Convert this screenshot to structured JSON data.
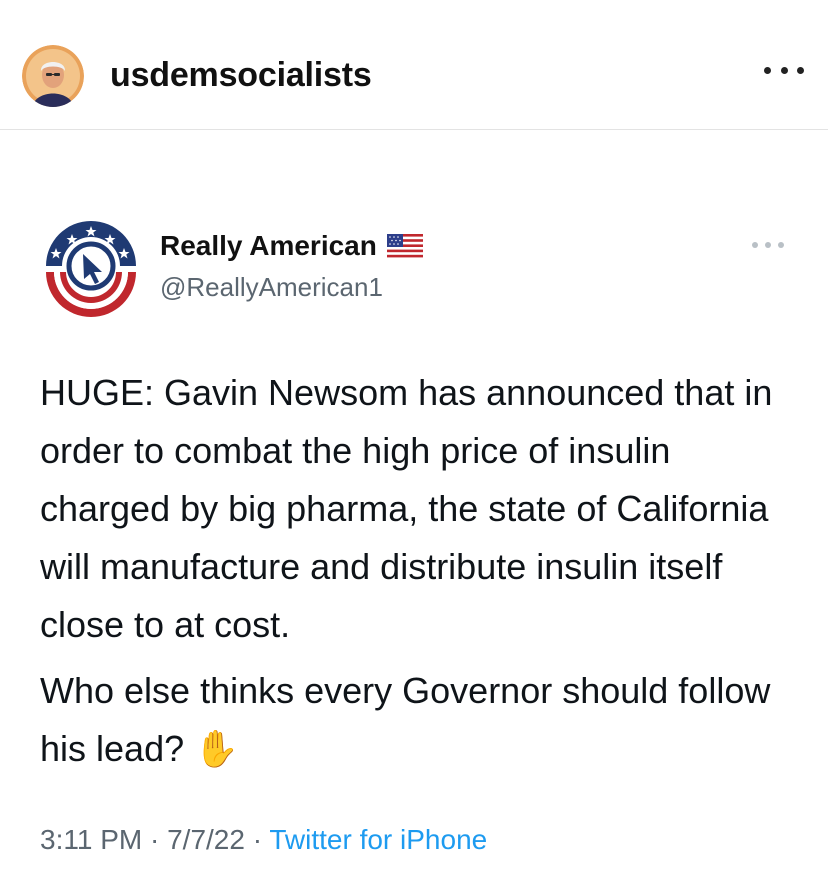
{
  "instagram_post": {
    "username": "usdemsocialists"
  },
  "tweet": {
    "display_name": "Really American",
    "flag_emoji": "🇺🇸",
    "handle": "@ReallyAmerican1",
    "paragraphs": [
      "HUGE: Gavin Newsom has announced that in order to combat the high price of insulin charged by big pharma, the state of California will manufacture and distribute insulin itself close to at cost.",
      "Who else thinks every Governor should follow his lead? ✋"
    ],
    "time": "3:11 PM",
    "date": "7/7/22",
    "separator": "·",
    "source": "Twitter for iPhone"
  },
  "colors": {
    "handle_gray": "#5b6670",
    "link_blue": "#1d9bf0",
    "logo_navy": "#1f3a73",
    "logo_red": "#c0272d"
  },
  "icons": {
    "ig_avatar": "avatar-portrait",
    "ig_more": "more-horizontal-icon",
    "tweet_more": "more-horizontal-icon",
    "tweet_logo": "really-american-logo",
    "flag": "us-flag-icon"
  }
}
